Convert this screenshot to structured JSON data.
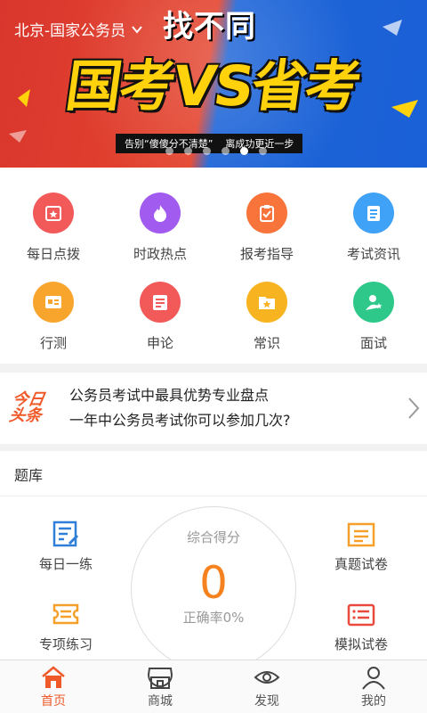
{
  "banner": {
    "region": "北京-国家公务员",
    "subtitle": "找不同",
    "headline": "国考VS省考",
    "tagline_left": "告别“傻傻分不清楚”",
    "tagline_right": "离成功更近一步",
    "dots_count": 6,
    "active_dot": 4
  },
  "grid": {
    "items": [
      {
        "label": "每日点拨",
        "color": "#f25a5a",
        "icon": "calendar-star-icon"
      },
      {
        "label": "时政热点",
        "color": "#a25bef",
        "icon": "flame-icon"
      },
      {
        "label": "报考指导",
        "color": "#f8743a",
        "icon": "clipboard-check-icon"
      },
      {
        "label": "考试资讯",
        "color": "#3fa2f7",
        "icon": "document-lines-icon"
      },
      {
        "label": "行测",
        "color": "#f8a52e",
        "icon": "id-card-icon"
      },
      {
        "label": "申论",
        "color": "#f25a5a",
        "icon": "newspaper-icon"
      },
      {
        "label": "常识",
        "color": "#f8b320",
        "icon": "folder-star-icon"
      },
      {
        "label": "面试",
        "color": "#2ec98a",
        "icon": "user-star-icon"
      }
    ]
  },
  "news": {
    "logo": "今日头条",
    "line1": "公务员考试中最具优势专业盘点",
    "line2": "一年中公务员考试你可以参加几次?"
  },
  "bank": {
    "title": "题库",
    "gauge_label": "综合得分",
    "score": "0",
    "rate": "正确率0%",
    "items": {
      "daily": "每日一练",
      "past": "真题试卷",
      "special": "专项练习",
      "mock": "模拟试卷"
    }
  },
  "tabbar": {
    "tabs": [
      {
        "label": "首页",
        "active": true
      },
      {
        "label": "商城",
        "active": false
      },
      {
        "label": "发现",
        "active": false
      },
      {
        "label": "我的",
        "active": false
      }
    ]
  },
  "colors": {
    "accent": "#f05a2a",
    "score": "#f5821f",
    "icon_blue": "#2f7fd8",
    "icon_orange": "#f5a02a",
    "icon_red": "#ea4a3d"
  }
}
